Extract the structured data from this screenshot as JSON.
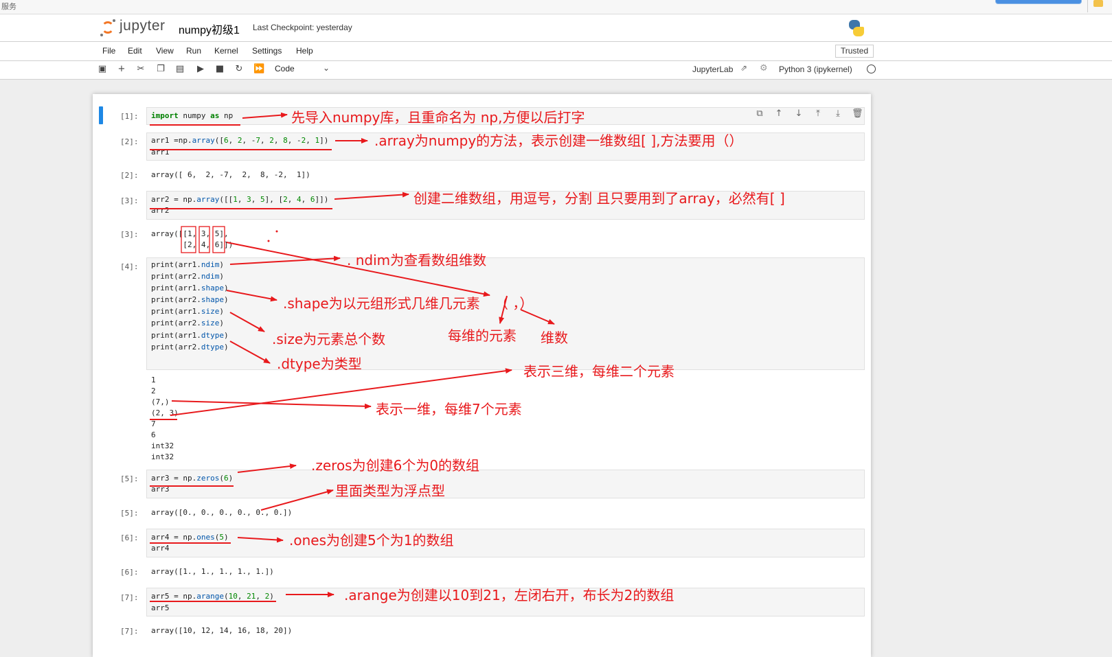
{
  "topstrip": {
    "label": "服务"
  },
  "header": {
    "brand": "jupyter",
    "notebook_name": "numpy初级1",
    "checkpoint": "Last Checkpoint: yesterday"
  },
  "menu": {
    "items": [
      "File",
      "Edit",
      "View",
      "Run",
      "Kernel",
      "Settings",
      "Help"
    ],
    "trusted": "Trusted"
  },
  "toolbar": {
    "cell_type": "Code",
    "jupyterlab": "JupyterLab",
    "kernel": "Python 3 (ipykernel)"
  },
  "prompts": {
    "p1": "[1]:",
    "p2": "[2]:",
    "p2o": "[2]:",
    "p3": "[3]:",
    "p3o": "[3]:",
    "p4": "[4]:",
    "p5": "[5]:",
    "p5o": "[5]:",
    "p6": "[6]:",
    "p6o": "[6]:",
    "p7": "[7]:",
    "p7o": "[7]:"
  },
  "outputs": {
    "o2": "array([ 6,  2, -7,  2,  8, -2,  1])",
    "o3_l1": "array([[1, 3, 5],",
    "o3_l2": "       [2, 4, 6]])",
    "o4": [
      "1",
      "2",
      "(7,)",
      "(2, 3)",
      "7",
      "6",
      "int32",
      "int32"
    ],
    "o5": "array([0., 0., 0., 0., 0., 0.])",
    "o6": "array([1., 1., 1., 1., 1.])",
    "o7": "array([10, 12, 14, 16, 18, 20])"
  },
  "code": {
    "c2_var": "arr1",
    "c3_var": "arr2",
    "c5_var": "arr3",
    "c6_var": "arr4",
    "c7_var": "arr5"
  },
  "annotations": {
    "a1": "先导入numpy库，且重命名为 np,方便以后打字",
    "a2": ".array为numpy的方法，表示创建一维数组[ ],方法要用（）",
    "a3": "创建二维数组，用逗号，分割    且只要用到了array，必然有[ ]",
    "a4": ". ndim为查看数组维数",
    "a5": ".shape为以元组形式几维几元素",
    "a6": "（ ，）",
    "a7": "每维的元素",
    "a8": "维数",
    "a9": ".size为元素总个数",
    "a10": ".dtype为类型",
    "a11": "表示三维，每维二个元素",
    "a12": "表示一维，每维7个元素",
    "a13": ".zeros为创建6个为0的数组",
    "a14": "里面类型为浮点型",
    "a15": ".ones为创建5个为1的数组",
    "a16": ".arange为创建以10到21，左闭右开，布长为2的数组"
  },
  "colors": {
    "annotation": "#e8191c",
    "accent": "#1e88e5",
    "brand": "#f37726"
  }
}
